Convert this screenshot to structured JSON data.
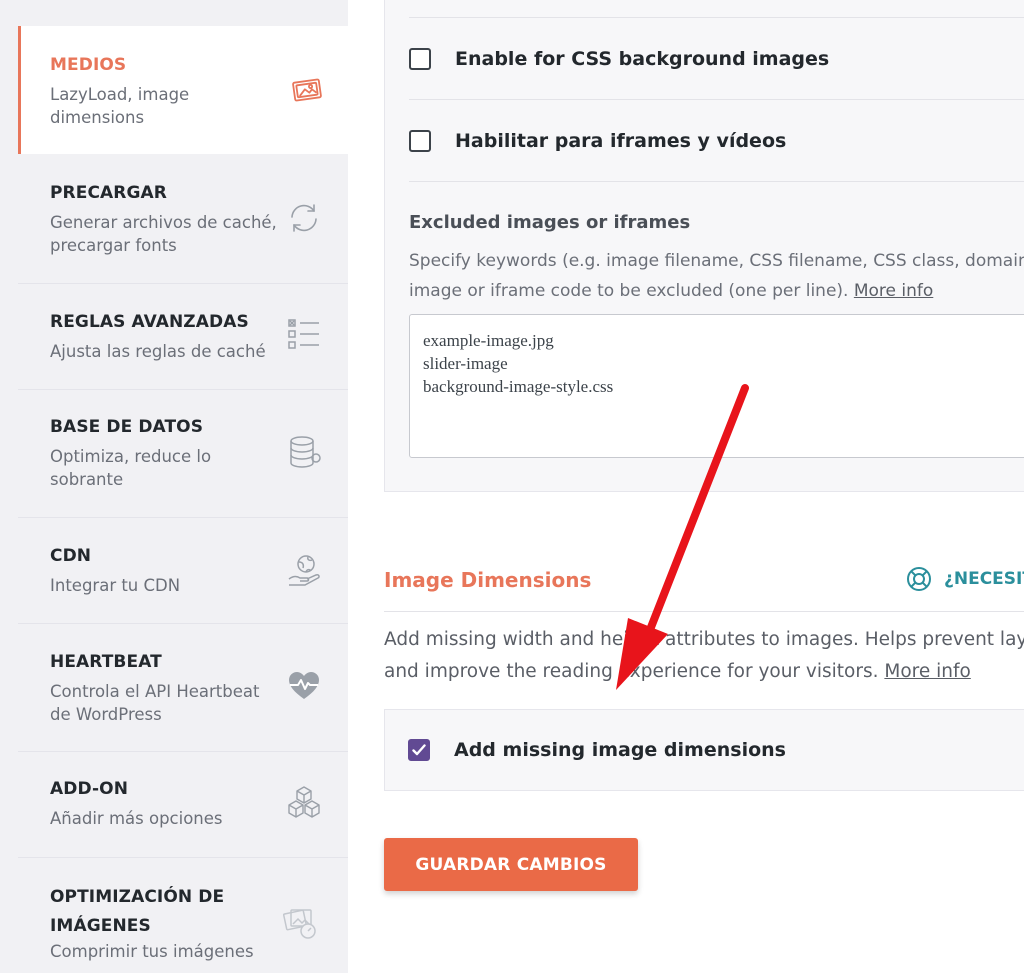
{
  "sidebar": {
    "items": [
      {
        "title": "MEDIOS",
        "desc": "LazyLoad, image dimensions",
        "icon": "media-icon",
        "active": true
      },
      {
        "title": "PRECARGAR",
        "desc": "Generar archivos de caché, precargar fonts",
        "icon": "refresh-icon"
      },
      {
        "title": "REGLAS AVANZADAS",
        "desc": "Ajusta las reglas de caché",
        "icon": "checklist-icon"
      },
      {
        "title": "BASE DE DATOS",
        "desc": "Optimiza, reduce lo sobrante",
        "icon": "database-icon"
      },
      {
        "title": "CDN",
        "desc": "Integrar tu CDN",
        "icon": "globe-hand-icon"
      },
      {
        "title": "HEARTBEAT",
        "desc": "Controla el API Heartbeat de WordPress",
        "icon": "heartbeat-icon"
      },
      {
        "title": "ADD-ON",
        "desc": "Añadir más opciones",
        "icon": "cubes-icon"
      },
      {
        "title": "OPTIMIZACIÓN DE IMÁGENES",
        "desc": "Comprimir tus imágenes",
        "icon": "image-optimization-icon"
      }
    ]
  },
  "lazyload": {
    "css_bg_label": "Enable for CSS background images",
    "css_bg_checked": false,
    "iframes_label": "Habilitar para iframes y vídeos",
    "iframes_checked": false,
    "excluded_title": "Excluded images or iframes",
    "excluded_help_line1": "Specify keywords (e.g. image filename, CSS filename, CSS class, domain) f",
    "excluded_help_line2": "image or iframe code to be excluded (one per line). ",
    "more_info": "More info",
    "excluded_value": "example-image.jpg\nslider-image\nbackground-image-style.css"
  },
  "image_dimensions": {
    "title": "Image Dimensions",
    "help_label": "¿NECESITA",
    "desc_line1": "Add missing width and height attributes to images. Helps prevent layou",
    "desc_line2": "and improve the reading experience for your visitors. ",
    "more_info": "More info",
    "checkbox_label": "Add missing image dimensions",
    "checked": true
  },
  "save_button": "GUARDAR CAMBIOS",
  "colors": {
    "accent": "#e8765a",
    "button": "#ea6a47",
    "checkbox": "#614a93",
    "help": "#2b8f9c",
    "arrow": "#e8141b"
  }
}
